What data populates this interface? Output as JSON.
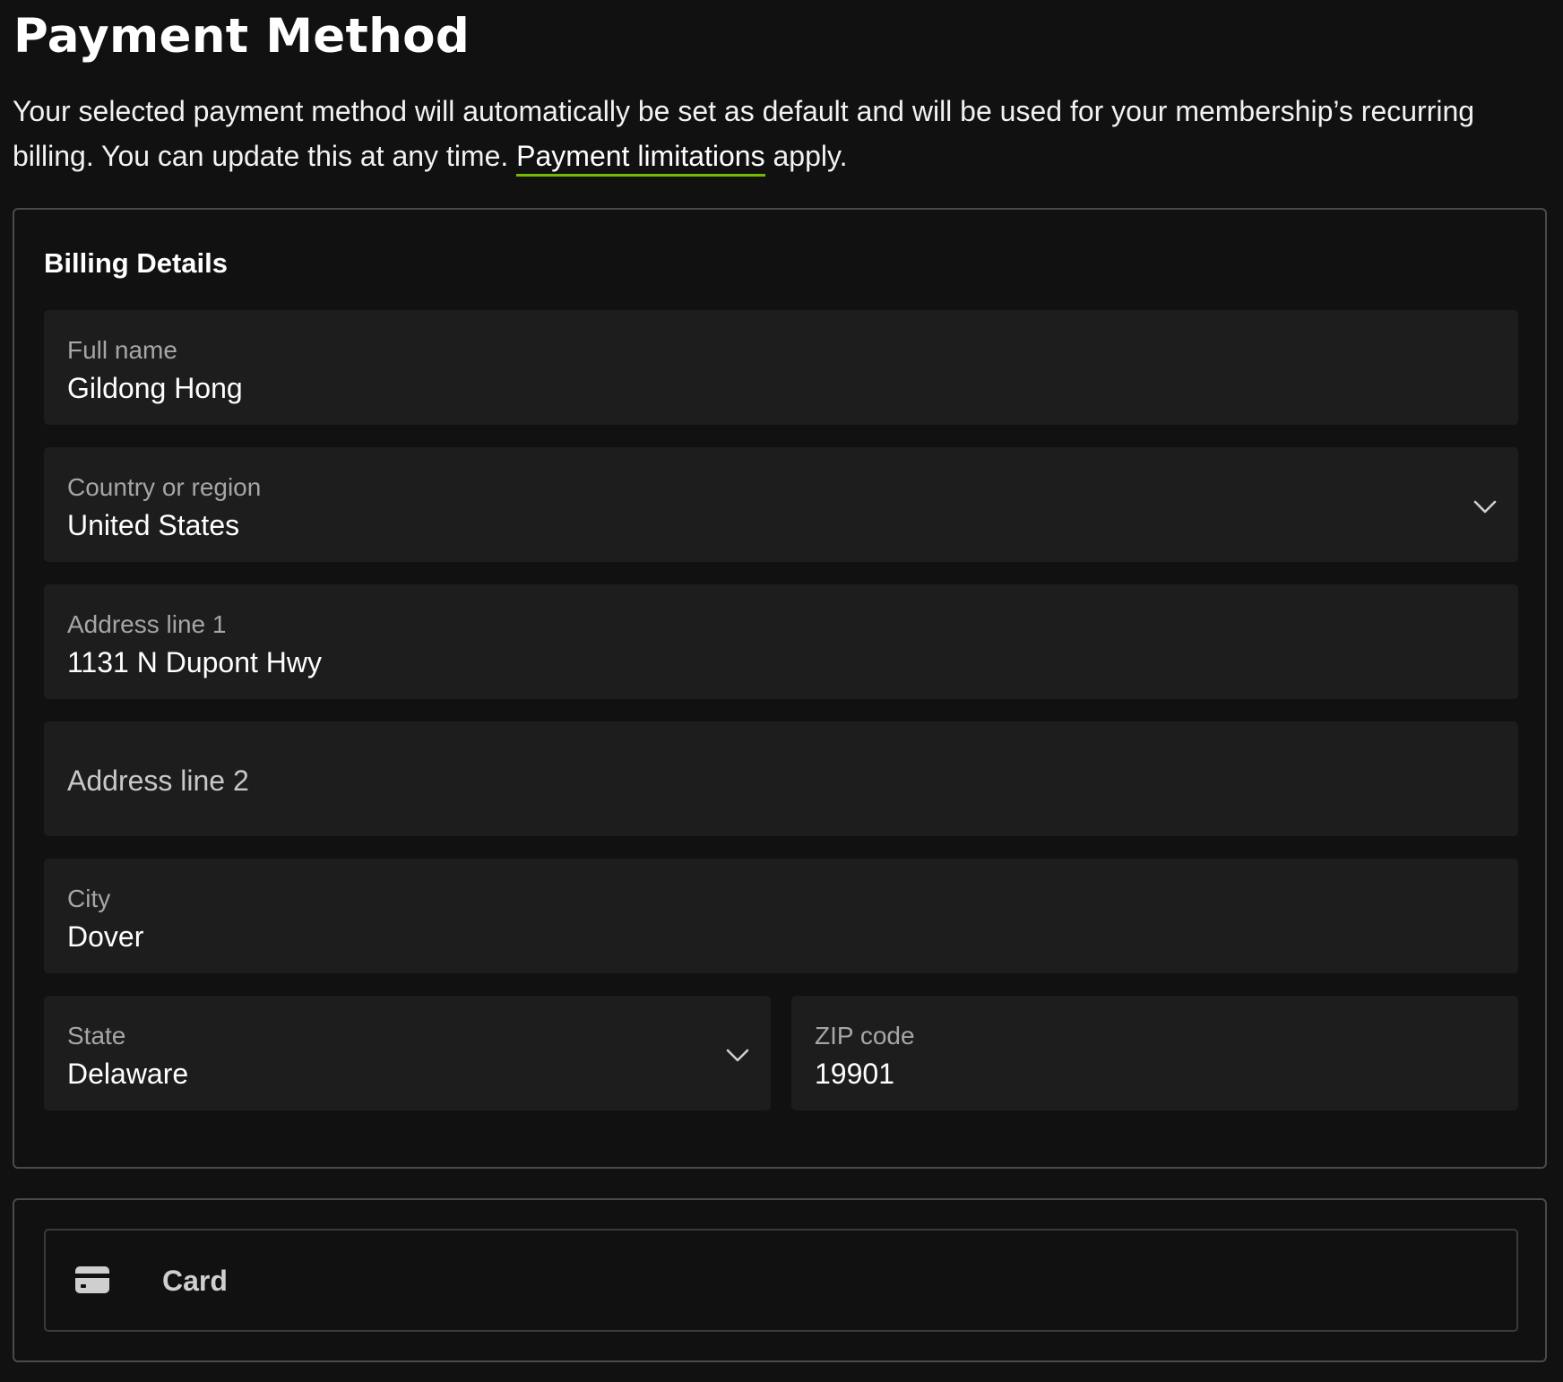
{
  "page": {
    "title": "Payment Method",
    "intro_text": "Your selected payment method will automatically be set as default and will be used for your membership’s recurring billing. You can update this at any time.",
    "intro_link": "Payment limitations",
    "intro_suffix": "apply.",
    "accent_color": "#76b900",
    "background_color": "#111111"
  },
  "billing": {
    "section_title": "Billing Details",
    "full_name": {
      "label": "Full name",
      "value": "Gildong Hong"
    },
    "country": {
      "label": "Country or region",
      "value": "United States",
      "icon": "chevron-down-icon"
    },
    "address1": {
      "label": "Address line 1",
      "value": "1131 N Dupont Hwy"
    },
    "address2": {
      "placeholder": "Address line 2"
    },
    "city": {
      "label": "City",
      "value": "Dover"
    },
    "state": {
      "label": "State",
      "value": "Delaware",
      "icon": "chevron-down-icon"
    },
    "zip": {
      "label": "ZIP code",
      "value": "19901"
    }
  },
  "payment_methods": {
    "card": {
      "label": "Card",
      "icon": "credit-card-icon"
    }
  }
}
